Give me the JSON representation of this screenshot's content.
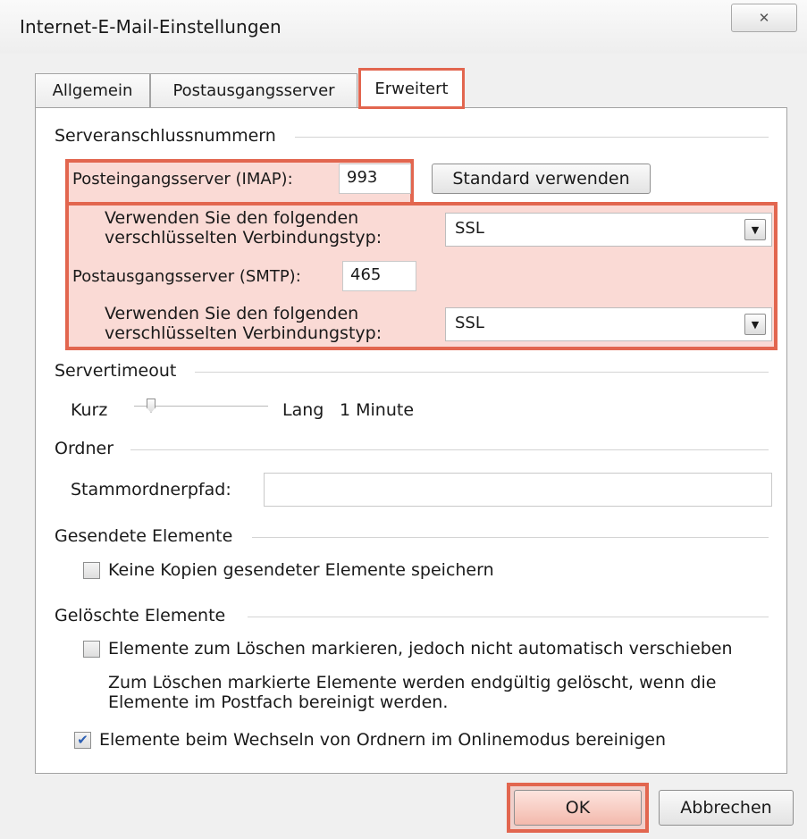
{
  "window": {
    "title": "Internet-E-Mail-Einstellungen",
    "close_glyph": "✕"
  },
  "tabs": [
    {
      "label": "Allgemein",
      "active": false
    },
    {
      "label": "Postausgangsserver",
      "active": false
    },
    {
      "label": "Erweitert",
      "active": true
    }
  ],
  "server_ports": {
    "group_label": "Serveranschlussnummern",
    "imap_label": "Posteingangsserver (IMAP):",
    "imap_value": "993",
    "default_button": "Standard verwenden",
    "encryption_label_line1": "Verwenden Sie den folgenden",
    "encryption_label_line2": "verschlüsselten Verbindungstyp:",
    "imap_encryption": "SSL",
    "smtp_label": "Postausgangsserver (SMTP):",
    "smtp_value": "465",
    "smtp_encryption": "SSL"
  },
  "timeout": {
    "group_label": "Servertimeout",
    "short_label": "Kurz",
    "long_label": "Lang",
    "value_label": "1 Minute",
    "slider_fraction": 0.1
  },
  "folders": {
    "group_label": "Ordner",
    "root_path_label": "Stammordnerpfad:",
    "root_path_value": ""
  },
  "sent_items": {
    "group_label": "Gesendete Elemente",
    "no_copies_label": "Keine Kopien gesendeter Elemente speichern",
    "no_copies_checked": false
  },
  "deleted_items": {
    "group_label": "Gelöschte Elemente",
    "mark_label": "Elemente zum Löschen markieren, jedoch nicht automatisch verschieben",
    "mark_checked": false,
    "note_line1": "Zum Löschen markierte Elemente werden endgültig gelöscht, wenn die",
    "note_line2": "Elemente im Postfach bereinigt werden.",
    "purge_label": "Elemente beim Wechseln von Ordnern im Onlinemodus bereinigen",
    "purge_checked": true,
    "check_glyph": "✔"
  },
  "footer": {
    "ok_label": "OK",
    "cancel_label": "Abbrechen"
  },
  "colors": {
    "highlight": "#e2664f",
    "highlight_fill": "#f29687"
  }
}
